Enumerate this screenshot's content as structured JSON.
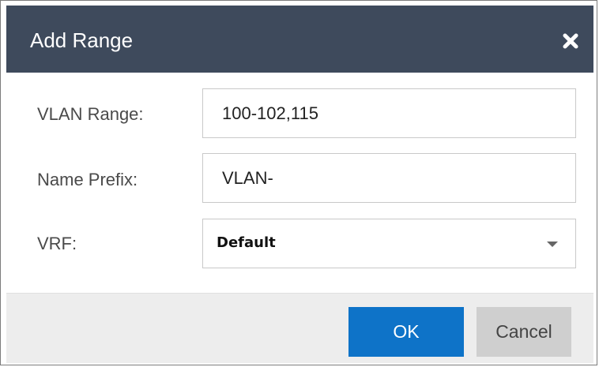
{
  "dialog": {
    "title": "Add Range",
    "close_icon": "close-icon"
  },
  "form": {
    "vlan_range": {
      "label": "VLAN Range:",
      "value": "100-102,115"
    },
    "name_prefix": {
      "label": "Name Prefix:",
      "value": "VLAN-"
    },
    "vrf": {
      "label": "VRF:",
      "selected": "Default",
      "dropdown_icon": "chevron-down-icon"
    }
  },
  "buttons": {
    "ok": "OK",
    "cancel": "Cancel"
  },
  "colors": {
    "titlebar": "#3e4a5c",
    "ok_button": "#0e73c8",
    "cancel_button": "#cfcfcf",
    "footer": "#ededed"
  }
}
